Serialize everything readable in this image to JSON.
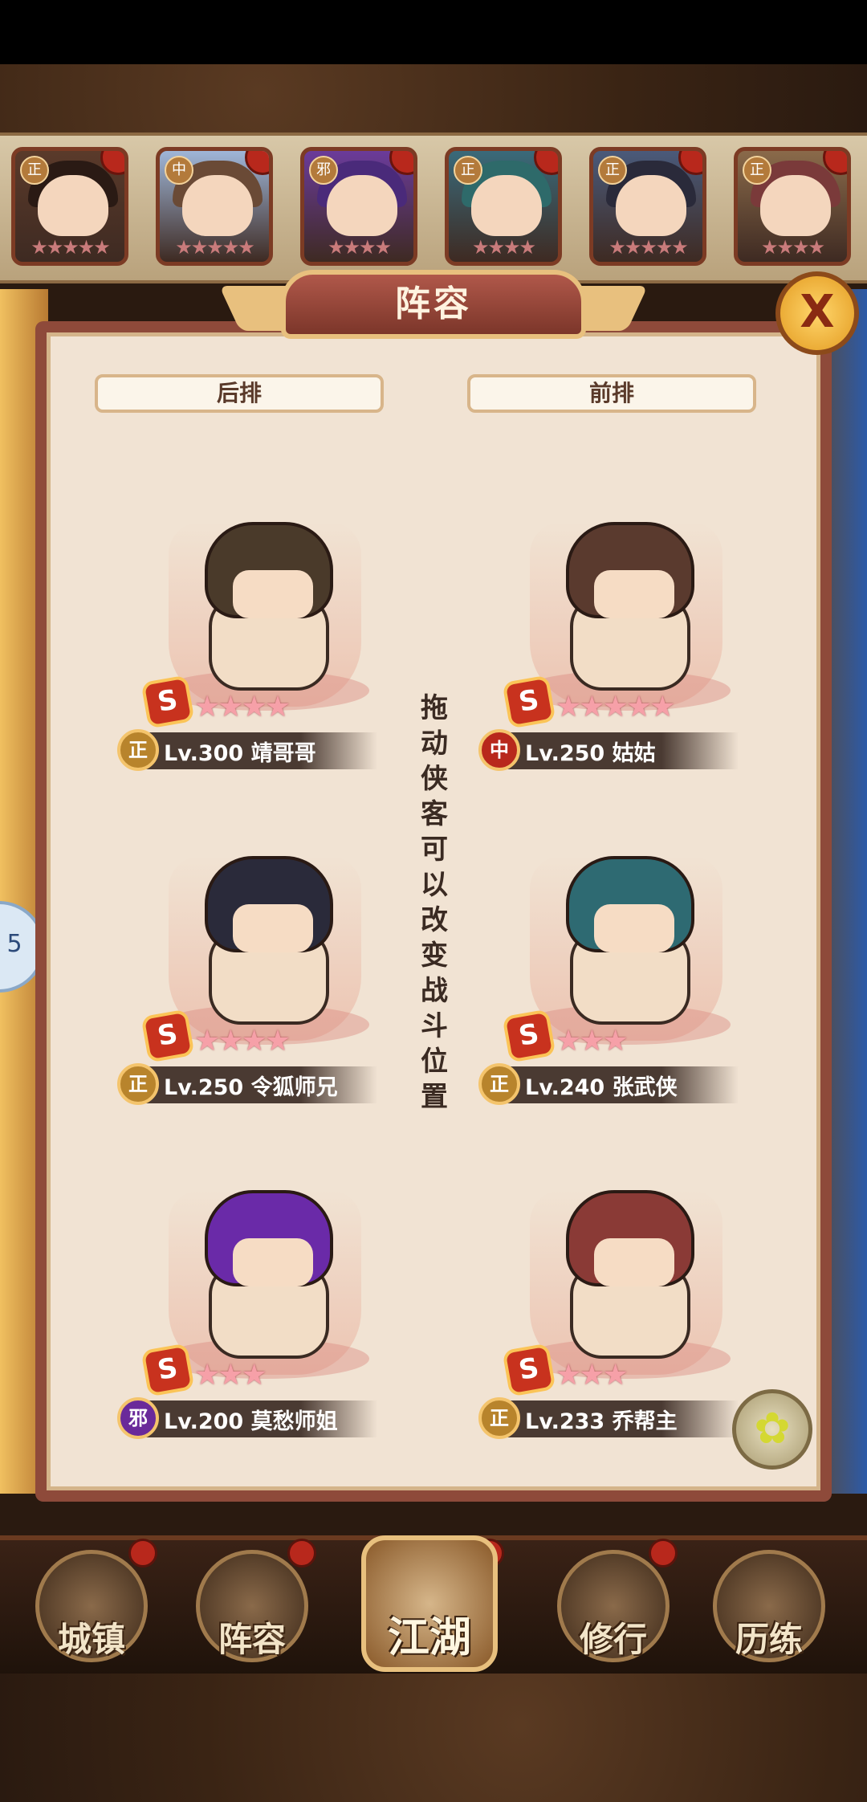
{
  "top_heroes": [
    {
      "faction": "正",
      "stars": "★★★★★",
      "hair": "#2a1a14",
      "robe": "#5a3a2a"
    },
    {
      "faction": "中",
      "stars": "★★★★★",
      "hair": "#6a4a36",
      "robe": "#9fb6d8"
    },
    {
      "faction": "邪",
      "stars": "★★★★",
      "hair": "#4a2a7a",
      "robe": "#6b3b9a"
    },
    {
      "faction": "正",
      "stars": "★★★★",
      "hair": "#2e6a6a",
      "robe": "#3a6a7a"
    },
    {
      "faction": "正",
      "stars": "★★★★★",
      "hair": "#2a2a3a",
      "robe": "#4a5a7a"
    },
    {
      "faction": "正",
      "stars": "★★★★",
      "hair": "#7a3a3a",
      "robe": "#8a6a4a"
    }
  ],
  "panel": {
    "title": "阵容",
    "close_icon": "X",
    "back_row_label": "后排",
    "front_row_label": "前排",
    "hint": [
      "拖",
      "动",
      "侠",
      "客",
      "可",
      "以",
      "改",
      "变",
      "战",
      "斗",
      "位",
      "置"
    ]
  },
  "slots": [
    {
      "rank": "S",
      "stars": "★★★★",
      "faction": "正",
      "faction_color": "#b8842c",
      "level": "Lv.300 靖哥哥",
      "hair": "#4a3a2a"
    },
    {
      "rank": "S",
      "stars": "★★★★★",
      "faction": "中",
      "faction_color": "#b8281c",
      "level": "Lv.250 姑姑",
      "hair": "#5a3a2e"
    },
    {
      "rank": "S",
      "stars": "★★★★",
      "faction": "正",
      "faction_color": "#b8842c",
      "level": "Lv.250 令狐师兄",
      "hair": "#2a2a3a"
    },
    {
      "rank": "S",
      "stars": "★★★",
      "faction": "正",
      "faction_color": "#b8842c",
      "level": "Lv.240 张武侠",
      "hair": "#2e6a72"
    },
    {
      "rank": "S",
      "stars": "★★★",
      "faction": "邪",
      "faction_color": "#6a2a9a",
      "level": "Lv.200 莫愁师姐",
      "hair": "#6a2aa8"
    },
    {
      "rank": "S",
      "stars": "★★★",
      "faction": "正",
      "faction_color": "#b8842c",
      "level": "Lv.233 乔帮主",
      "hair": "#8a3a36"
    }
  ],
  "left_bubble": "5",
  "feature_icon": "✿",
  "nav": {
    "town": "城镇",
    "lineup": "阵容",
    "jianghu": "江湖",
    "cultivate": "修行",
    "train": "历练"
  }
}
